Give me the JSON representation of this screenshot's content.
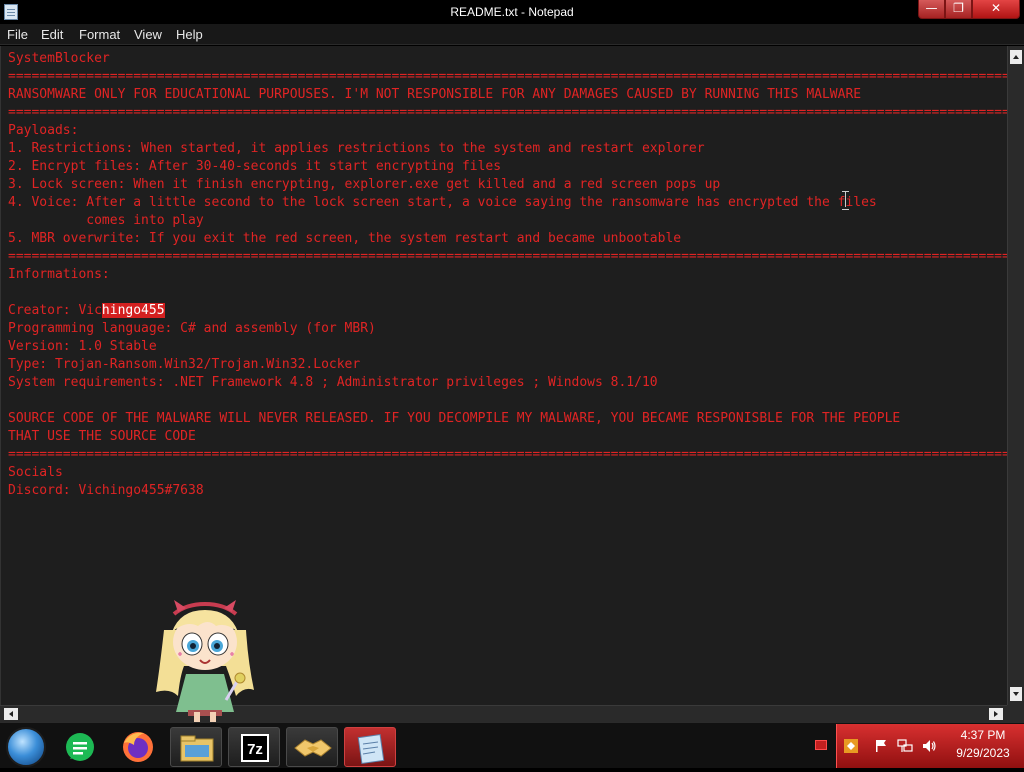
{
  "window": {
    "title": "README.txt - Notepad",
    "min_glyph": "—",
    "max_glyph": "❐",
    "close_glyph": "✕"
  },
  "menu": [
    "File",
    "Edit",
    "Format",
    "View",
    "Help"
  ],
  "document": {
    "lines": [
      "SystemBlocker",
      "==================================================================================================================================",
      "RANSOMWARE ONLY FOR EDUCATIONAL PURPOUSES. I'M NOT RESPONSIBLE FOR ANY DAMAGES CAUSED BY RUNNING THIS MALWARE",
      "==================================================================================================================================",
      "Payloads:",
      "1. Restrictions: When started, it applies restrictions to the system and restart explorer",
      "2. Encrypt files: After 30-40-seconds it start encrypting files",
      "3. Lock screen: When it finish encrypting, explorer.exe get killed and a red screen pops up",
      "4. Voice: After a little second to the lock screen start, a voice saying the ransomware has encrypted the files",
      "          comes into play",
      "5. MBR overwrite: If you exit the red screen, the system restart and became unbootable",
      "==================================================================================================================================",
      "Informations:",
      "",
      "Creator: Vichingo455",
      "Programming language: C# and assembly (for MBR)",
      "Version: 1.0 Stable",
      "Type: Trojan-Ransom.Win32/Trojan.Win32.Locker",
      "System requirements: .NET Framework 4.8 ; Administrator privileges ; Windows 8.1/10",
      "",
      "SOURCE CODE OF THE MALWARE WILL NEVER RELEASED. IF YOU DECOMPILE MY MALWARE, YOU BECAME RESPONISBLE FOR THE PEOPLE",
      "THAT USE THE SOURCE CODE",
      "==================================================================================================================================",
      "Socials",
      "Discord: Vichingo455#7638"
    ],
    "creator_prefix": "Creator: Vic",
    "creator_selected": "hingo455"
  },
  "taskbar": {
    "apps": [
      "start-orb",
      "messages",
      "firefox",
      "file-explorer",
      "7-zip",
      "handshake-app",
      "notepad"
    ],
    "sevenzip_label": "7z"
  },
  "tray": {
    "time": "4:37 PM",
    "date": "9/29/2023"
  },
  "colors": {
    "text": "#e02424",
    "background": "#1e1e1e",
    "accent": "#c42020"
  }
}
